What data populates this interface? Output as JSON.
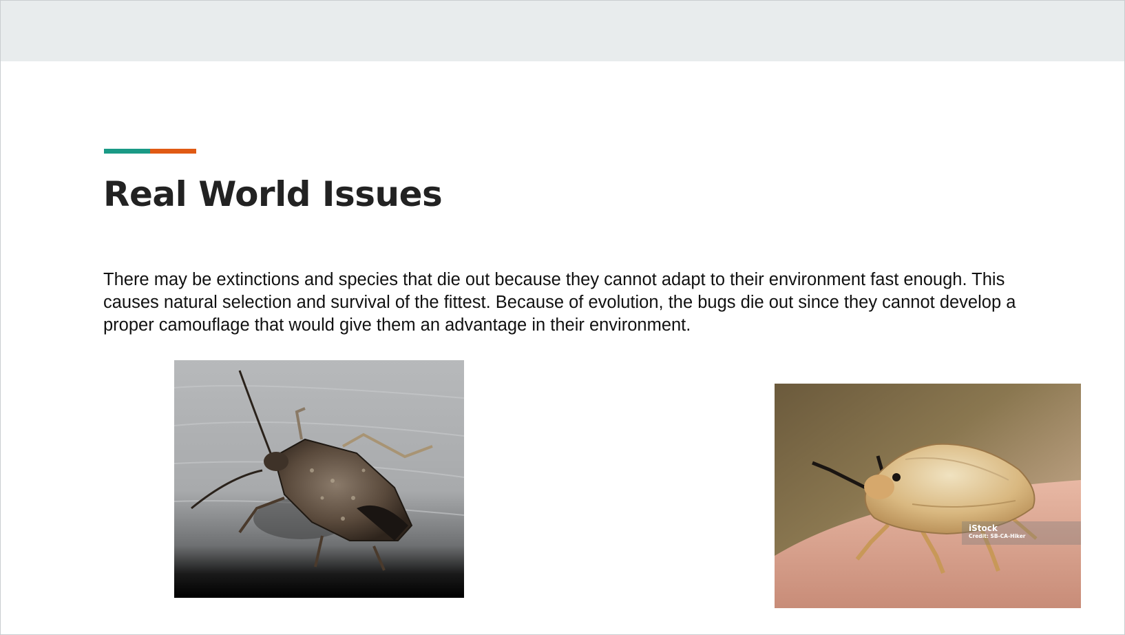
{
  "slide": {
    "title": "Real World Issues",
    "body": "There may be extinctions and species that die out because they cannot adapt to their environment fast enough. This causes natural selection and survival of the fittest. Because of evolution, the bugs die out since they cannot develop a proper camouflage that would give them an advantage in their environment.",
    "accent_colors": [
      "#1a9a86",
      "#e05a14"
    ],
    "header_band_color": "#e8eced"
  },
  "images": {
    "left": {
      "name": "stink bug on gray wood"
    },
    "right": {
      "name": "tan shield bug on skin",
      "watermark_brand": "iStock",
      "watermark_credit": "Credit: SB-CA-Hiker"
    }
  }
}
